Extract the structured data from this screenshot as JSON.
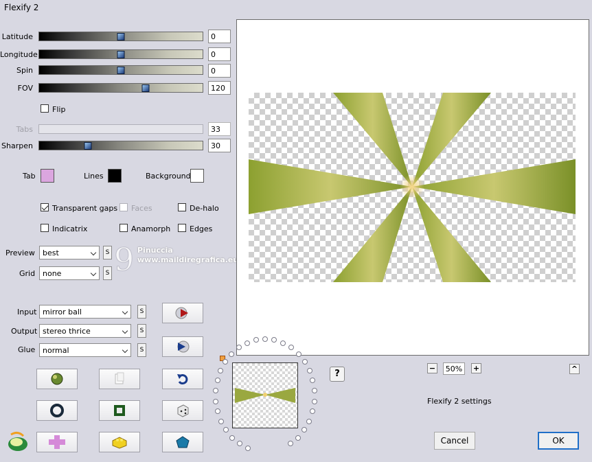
{
  "window": {
    "title": "Flexify 2"
  },
  "sliders": [
    {
      "id": "latitude",
      "label": "Latitude",
      "value": "0",
      "level": 0.5,
      "disabled": false
    },
    {
      "id": "longitude",
      "label": "Longitude",
      "value": "0",
      "level": 0.5,
      "disabled": false
    },
    {
      "id": "spin",
      "label": "Spin",
      "value": "0",
      "level": 0.5,
      "disabled": false
    },
    {
      "id": "fov",
      "label": "FOV",
      "value": "120",
      "level": 0.65,
      "disabled": false
    },
    {
      "id": "tabs",
      "label": "Tabs",
      "value": "33",
      "level": 0.3,
      "disabled": true
    },
    {
      "id": "sharpen",
      "label": "Sharpen",
      "value": "30",
      "level": 0.3,
      "disabled": false
    }
  ],
  "flip": {
    "label": "Flip",
    "checked": false
  },
  "colors": {
    "tab": {
      "label": "Tab",
      "color": "#dba6df"
    },
    "lines": {
      "label": "Lines",
      "color": "#000000"
    },
    "background": {
      "label": "Background",
      "color": "#ffffff"
    }
  },
  "options": {
    "transparent_gaps": {
      "label": "Transparent gaps",
      "checked": true
    },
    "faces": {
      "label": "Faces",
      "checked": false,
      "disabled": true
    },
    "dehalo": {
      "label": "De-halo",
      "checked": false
    },
    "indicatrix": {
      "label": "Indicatrix",
      "checked": false
    },
    "anamorph": {
      "label": "Anamorph",
      "checked": false
    },
    "edges": {
      "label": "Edges",
      "checked": false
    }
  },
  "preview_select": {
    "label": "Preview",
    "value": "best",
    "s": "S"
  },
  "grid_select": {
    "label": "Grid",
    "value": "none",
    "s": "S"
  },
  "input_select": {
    "label": "Input",
    "value": "mirror ball",
    "s": "S"
  },
  "output_select": {
    "label": "Output",
    "value": "stereo thrice",
    "s": "S"
  },
  "glue_select": {
    "label": "Glue",
    "value": "normal",
    "s": "S"
  },
  "watermark": {
    "name": "Pinuccia",
    "url": "www.maildiregrafica.eu"
  },
  "zoom": {
    "minus": "−",
    "value": "50%",
    "plus": "+",
    "collapse": "^"
  },
  "help": {
    "label": "?"
  },
  "status": {
    "text": "Flexify 2 settings"
  },
  "buttons": {
    "cancel": "Cancel",
    "ok": "OK"
  },
  "accent": {
    "artwork": "#9aa840",
    "highlight": "#f0d070",
    "ok_border": "#1f6fc8"
  }
}
